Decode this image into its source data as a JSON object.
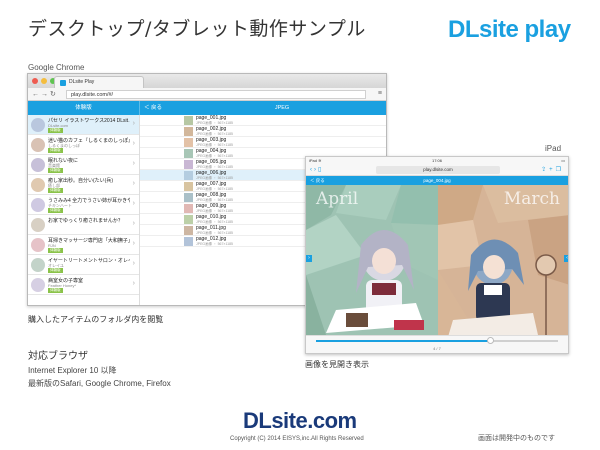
{
  "slide": {
    "title": "デスクトップ/タブレット動作サンプル",
    "brand": "DLsite play",
    "brand_color": "#1aa0e0"
  },
  "chrome": {
    "label": "Google Chrome",
    "tab_title": "DLsite Play",
    "url": "play.dlsite.com/#/",
    "header_left": "体験版",
    "header_back": "＜ 戻る",
    "header_center": "JPEG",
    "sidebar": [
      {
        "title": "パセリ イラストワークス2014 DLsit…",
        "sub": "DLsite.com",
        "tag": "体験版"
      },
      {
        "title": "迷い猫のカフェ『しるくまのしっぽ』",
        "sub": "しるくまのしっぽ",
        "tag": "体験版"
      },
      {
        "title": "眠れない夜に",
        "sub": "音楽館",
        "tag": "体験版"
      },
      {
        "title": "癒し家出秒。自分い(たい(兵)",
        "sub": "癒し部",
        "tag": "体験版"
      },
      {
        "title": "うさみみ4 全力でうさい姉が耳かきや…",
        "sub": "チキンハート",
        "tag": "体験版"
      },
      {
        "title": "お家でゆっくり癒されませんか？",
        "sub": "",
        "tag": ""
      },
      {
        "title": "耳掃きマッサージ専門店「大和撫子」…",
        "sub": "RJN",
        "tag": "体験版"
      },
      {
        "title": "イヤートリートメントサロン・オレイ…",
        "sub": "オレイユ",
        "tag": "体験版"
      },
      {
        "title": "病室女の子専室",
        "sub": "Feather Honey*",
        "tag": "体験版"
      }
    ],
    "files": [
      {
        "name": "page_001.jpg",
        "meta": "JPEG画像 ・ 567×1185"
      },
      {
        "name": "page_002.jpg",
        "meta": "JPEG画像 ・ 567×1185"
      },
      {
        "name": "page_003.jpg",
        "meta": "JPEG画像 ・ 567×1185"
      },
      {
        "name": "page_004.jpg",
        "meta": "JPEG画像 ・ 567×1185"
      },
      {
        "name": "page_005.jpg",
        "meta": "JPEG画像 ・ 567×1185"
      },
      {
        "name": "page_006.jpg",
        "meta": "JPEG画像 ・ 567×1185"
      },
      {
        "name": "page_007.jpg",
        "meta": "JPEG画像 ・ 567×1185"
      },
      {
        "name": "page_008.jpg",
        "meta": "JPEG画像 ・ 567×1185"
      },
      {
        "name": "page_009.jpg",
        "meta": "JPEG画像 ・ 567×1185"
      },
      {
        "name": "page_010.jpg",
        "meta": "JPEG画像 ・ 567×1185"
      },
      {
        "name": "page_011.jpg",
        "meta": "JPEG画像 ・ 567×1185"
      },
      {
        "name": "page_012.jpg",
        "meta": "JPEG画像 ・ 567×1185"
      }
    ],
    "caption": "購入したアイテムのフォルダ内を閲覧"
  },
  "ipad": {
    "label": "iPad",
    "time": "17:06",
    "url": "play.dlsite.com",
    "header_back": "＜ 戻る",
    "header_title": "page_004.jpg",
    "left_page_word": "April",
    "right_page_word": "March",
    "page_count": "4 / 7",
    "progress": 0.72,
    "caption": "画像を見開き表示"
  },
  "browsers": {
    "heading": "対応ブラウザ",
    "line1": "Internet Explorer 10 以降",
    "line2": "最新版のSafari, Google Chrome, Firefox"
  },
  "footer": {
    "logo": "DLsite.com",
    "copyright": "Copyright (C) 2014 EISYS,inc.All Rights Reserved",
    "note": "画面は開発中のものです"
  },
  "colors": {
    "accent": "#1aa0e0",
    "footer_logo": "#1a3a7a",
    "tag": "#8bc34a"
  }
}
